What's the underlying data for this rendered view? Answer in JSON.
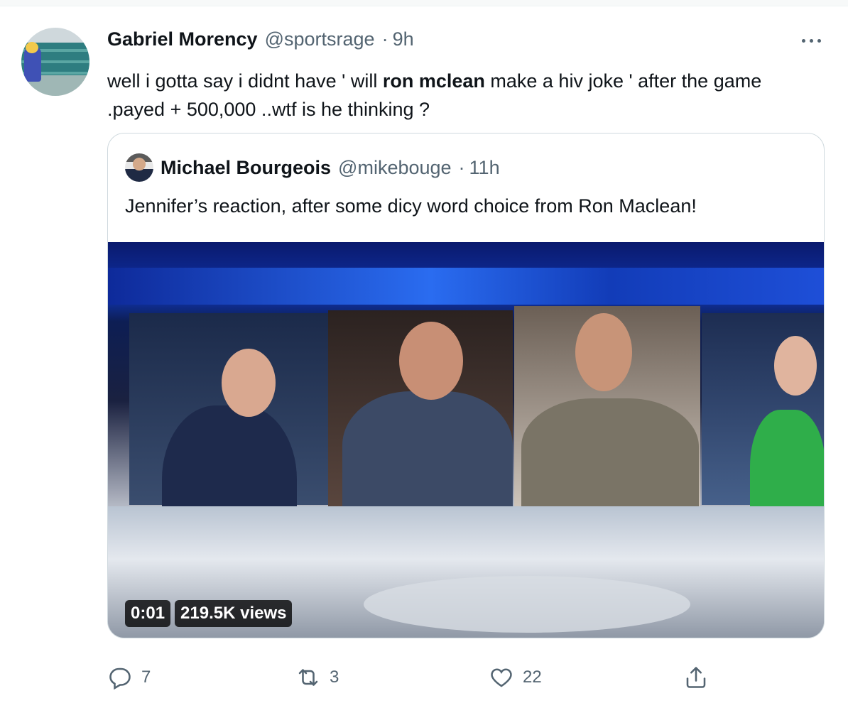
{
  "tweet": {
    "author_name": "Gabriel Morency",
    "handle": "@sportsrage",
    "dot": "·",
    "time": "9h",
    "text_before": "well i gotta say i didnt have ' will ",
    "text_bold": "ron mclean",
    "text_after": " make a hiv joke ' after the game .payed + 500,000 ..wtf is he thinking ?"
  },
  "quoted": {
    "author_name": "Michael Bourgeois",
    "handle": "@mikebouge",
    "dot": "·",
    "time": "11h",
    "text": "Jennifer’s reaction, after some dicy word choice from Ron Maclean!",
    "video": {
      "timestamp": "0:01",
      "views": "219.5K views"
    }
  },
  "actions": {
    "reply_count": "7",
    "retweet_count": "3",
    "like_count": "22"
  },
  "icons": [
    "more-icon",
    "reply-icon",
    "retweet-icon",
    "like-icon",
    "share-icon"
  ],
  "colors": {
    "muted": "#536471",
    "border": "#cfd9de"
  }
}
